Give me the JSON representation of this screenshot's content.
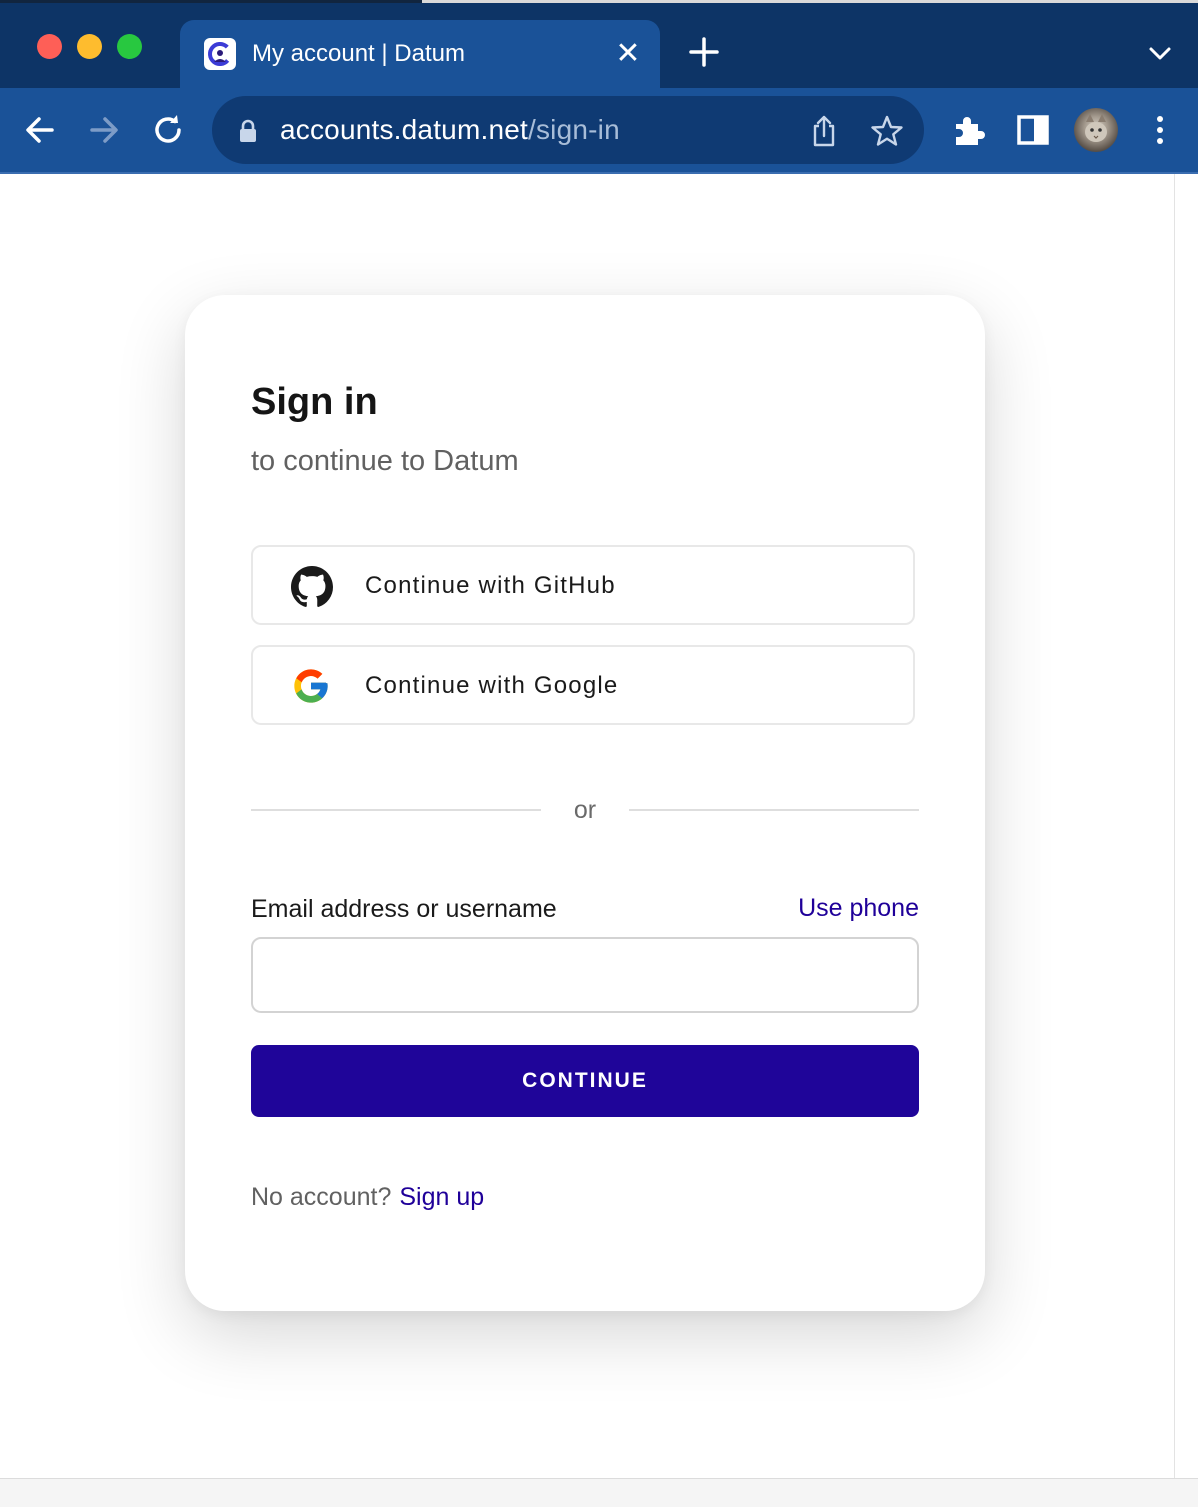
{
  "browser": {
    "tab": {
      "title": "My account | Datum",
      "close_symbol": "✕",
      "favicon": "datum-logo-icon"
    },
    "omnibox": {
      "url_host": "accounts.datum.net",
      "url_path": "/sign-in"
    },
    "icons": [
      "back-arrow-icon",
      "forward-arrow-icon",
      "reload-icon",
      "lock-icon",
      "share-icon",
      "star-icon",
      "extensions-icon",
      "side-panel-icon",
      "profile-avatar",
      "more-menu-icon",
      "new-tab-icon",
      "tab-list-icon"
    ]
  },
  "signin": {
    "title": "Sign in",
    "subtitle": "to continue to Datum",
    "github_label": "Continue with GitHub",
    "google_label": "Continue with Google",
    "divider_text": "or",
    "email_label": "Email address or username",
    "use_phone_label": "Use phone",
    "email_value": "",
    "continue_label": "CONTINUE",
    "no_account_text": "No account?",
    "signup_label": "Sign up"
  },
  "colors": {
    "tabstrip_bg": "#0d3466",
    "toolbar_bg": "#1a5298",
    "primary_button": "#1f0599",
    "link": "#1f0099"
  }
}
